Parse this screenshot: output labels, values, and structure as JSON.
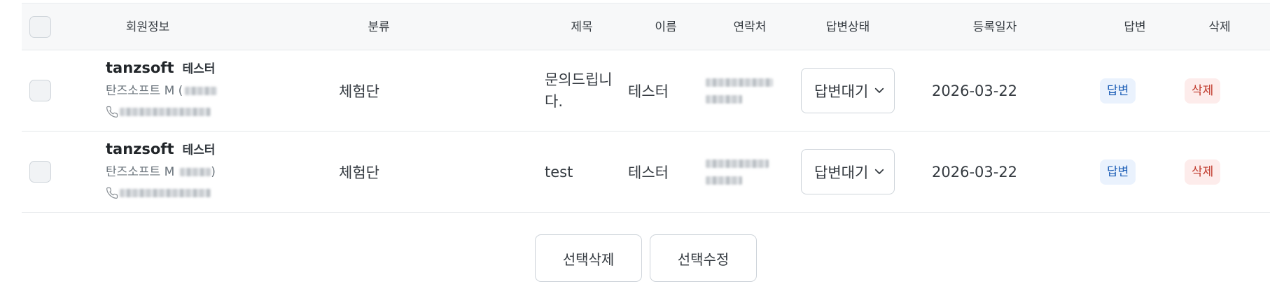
{
  "header": {
    "member_info": "회원정보",
    "category": "분류",
    "title": "제목",
    "name": "이름",
    "contact": "연락처",
    "answer_status": "답변상태",
    "reg_date": "등록일자",
    "answer": "답변",
    "delete": "삭제"
  },
  "rows": [
    {
      "member_id": "tanzsoft",
      "member_nick": "테스터",
      "member_company": "탄즈소프트 M (",
      "category": "체험단",
      "title": "문의드립니다.",
      "name": "테스터",
      "status": "답변대기",
      "date": "2026-03-22",
      "answer_label": "답변",
      "delete_label": "삭제"
    },
    {
      "member_id": "tanzsoft",
      "member_nick": "테스터",
      "member_company": "탄즈소프트 M",
      "member_company_suffix": ")",
      "category": "체험단",
      "title": "test",
      "name": "테스터",
      "status": "답변대기",
      "date": "2026-03-22",
      "answer_label": "답변",
      "delete_label": "삭제"
    }
  ],
  "footer": {
    "delete_selected": "선택삭제",
    "edit_selected": "선택수정"
  },
  "colors": {
    "answer_bg": "#eaf2fd",
    "answer_text": "#1d5fb7",
    "delete_bg": "#fdeceb",
    "delete_text": "#c0392b"
  },
  "icons": {
    "phone": "phone-icon",
    "select_chevron": "chevron-down-icon"
  }
}
